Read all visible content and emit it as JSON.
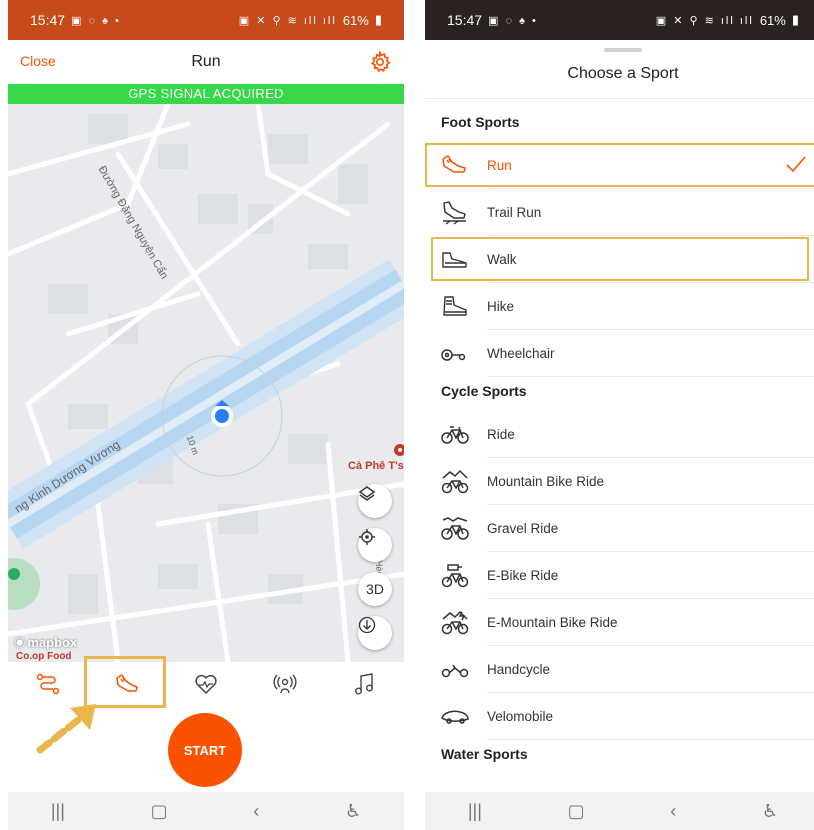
{
  "colors": {
    "accent": "#fc5200",
    "gps_green": "#36d84a",
    "highlight": "#e8b64a"
  },
  "left": {
    "status": {
      "time": "15:47",
      "battery": "61%"
    },
    "header": {
      "close_label": "Close",
      "title": "Run",
      "settings_icon": "gear-icon"
    },
    "gps_banner": "GPS SIGNAL ACQUIRED",
    "map": {
      "street_1": "Đường Đặng Nguyên Cẩn",
      "street_2": "ng Kinh Dương Vương",
      "distance_label": "10 m",
      "poi": "Cà Phê T's",
      "side_street": "Hẻm 5",
      "buttons": {
        "three_d": "3D"
      },
      "attribution": "mapbox",
      "poi_bottom": "Co.op Food"
    },
    "tabs": [
      {
        "name": "route",
        "icon": "route-icon"
      },
      {
        "name": "sport",
        "icon": "run-shoe-icon"
      },
      {
        "name": "heart-rate",
        "icon": "heart-rate-icon"
      },
      {
        "name": "beacon",
        "icon": "beacon-icon"
      },
      {
        "name": "music",
        "icon": "music-icon"
      }
    ],
    "start_label": "START"
  },
  "right": {
    "status": {
      "time": "15:47",
      "battery": "61%"
    },
    "title": "Choose a Sport",
    "sections": [
      {
        "heading": "Foot Sports",
        "items": [
          {
            "label": "Run",
            "icon": "run-shoe-icon",
            "selected": true
          },
          {
            "label": "Trail Run",
            "icon": "trail-run-icon"
          },
          {
            "label": "Walk",
            "icon": "walk-shoe-icon"
          },
          {
            "label": "Hike",
            "icon": "hike-boot-icon"
          },
          {
            "label": "Wheelchair",
            "icon": "wheelchair-icon"
          }
        ]
      },
      {
        "heading": "Cycle Sports",
        "items": [
          {
            "label": "Ride",
            "icon": "bike-icon"
          },
          {
            "label": "Mountain Bike Ride",
            "icon": "mountain-bike-icon"
          },
          {
            "label": "Gravel Ride",
            "icon": "gravel-bike-icon"
          },
          {
            "label": "E-Bike Ride",
            "icon": "ebike-icon"
          },
          {
            "label": "E-Mountain Bike Ride",
            "icon": "emountain-bike-icon"
          },
          {
            "label": "Handcycle",
            "icon": "handcycle-icon"
          },
          {
            "label": "Velomobile",
            "icon": "velomobile-icon"
          }
        ]
      },
      {
        "heading": "Water Sports",
        "items": []
      }
    ]
  }
}
